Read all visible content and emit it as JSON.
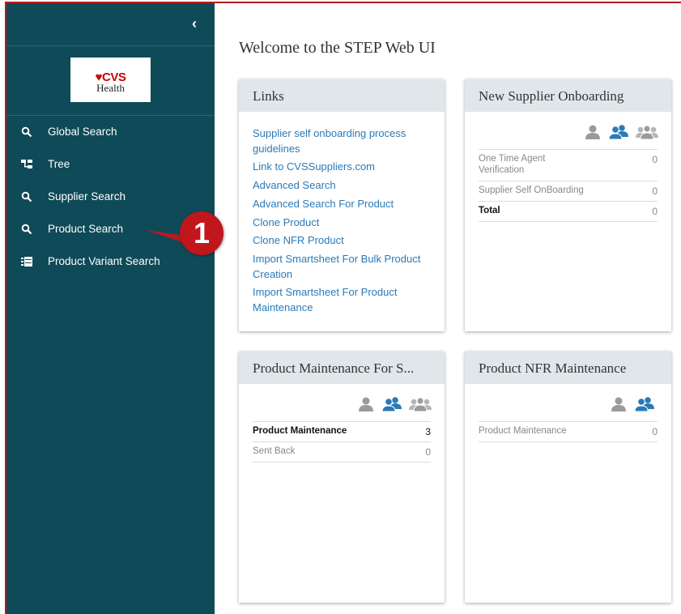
{
  "sidebar": {
    "collapse_glyph": "‹",
    "logo": {
      "brand": "♥CVS",
      "sub": "Health"
    },
    "items": [
      {
        "label": "Global Search",
        "icon": "search-icon"
      },
      {
        "label": "Tree",
        "icon": "tree-icon"
      },
      {
        "label": "Supplier Search",
        "icon": "search-icon"
      },
      {
        "label": "Product Search",
        "icon": "search-icon"
      },
      {
        "label": "Product Variant Search",
        "icon": "list-icon"
      }
    ]
  },
  "main": {
    "welcome": "Welcome to the STEP Web UI",
    "cards": {
      "links": {
        "title": "Links",
        "items": [
          "Supplier self onboarding process guidelines",
          "Link to CVSSuppliers.com",
          "Advanced Search",
          "Advanced Search For Product",
          "Clone Product",
          "Clone NFR Product",
          "Import Smartsheet For Bulk Product Creation",
          "Import Smartsheet For Product Maintenance"
        ]
      },
      "supplier_onboarding": {
        "title": "New Supplier Onboarding",
        "rows": [
          {
            "label": "One Time Agent Verification",
            "value": "0"
          },
          {
            "label": "Supplier Self OnBoarding",
            "value": "0"
          },
          {
            "label": "Total",
            "value": "0"
          }
        ]
      },
      "product_maintenance": {
        "title": "Product Maintenance For S...",
        "rows": [
          {
            "label": "Product Maintenance",
            "value": "3"
          },
          {
            "label": "Sent Back",
            "value": "0"
          }
        ]
      },
      "nfr_maintenance": {
        "title": "Product NFR Maintenance",
        "rows": [
          {
            "label": "Product Maintenance",
            "value": "0"
          }
        ]
      }
    }
  },
  "callout": {
    "number": "1"
  },
  "colors": {
    "sidebar": "#0f4a59",
    "link": "#2a7ab7",
    "card_header": "#dfe7ea",
    "user_icon_active": "#2a7ab7",
    "user_icon_inactive": "#9a9a9a",
    "callout": "#c0161c"
  }
}
